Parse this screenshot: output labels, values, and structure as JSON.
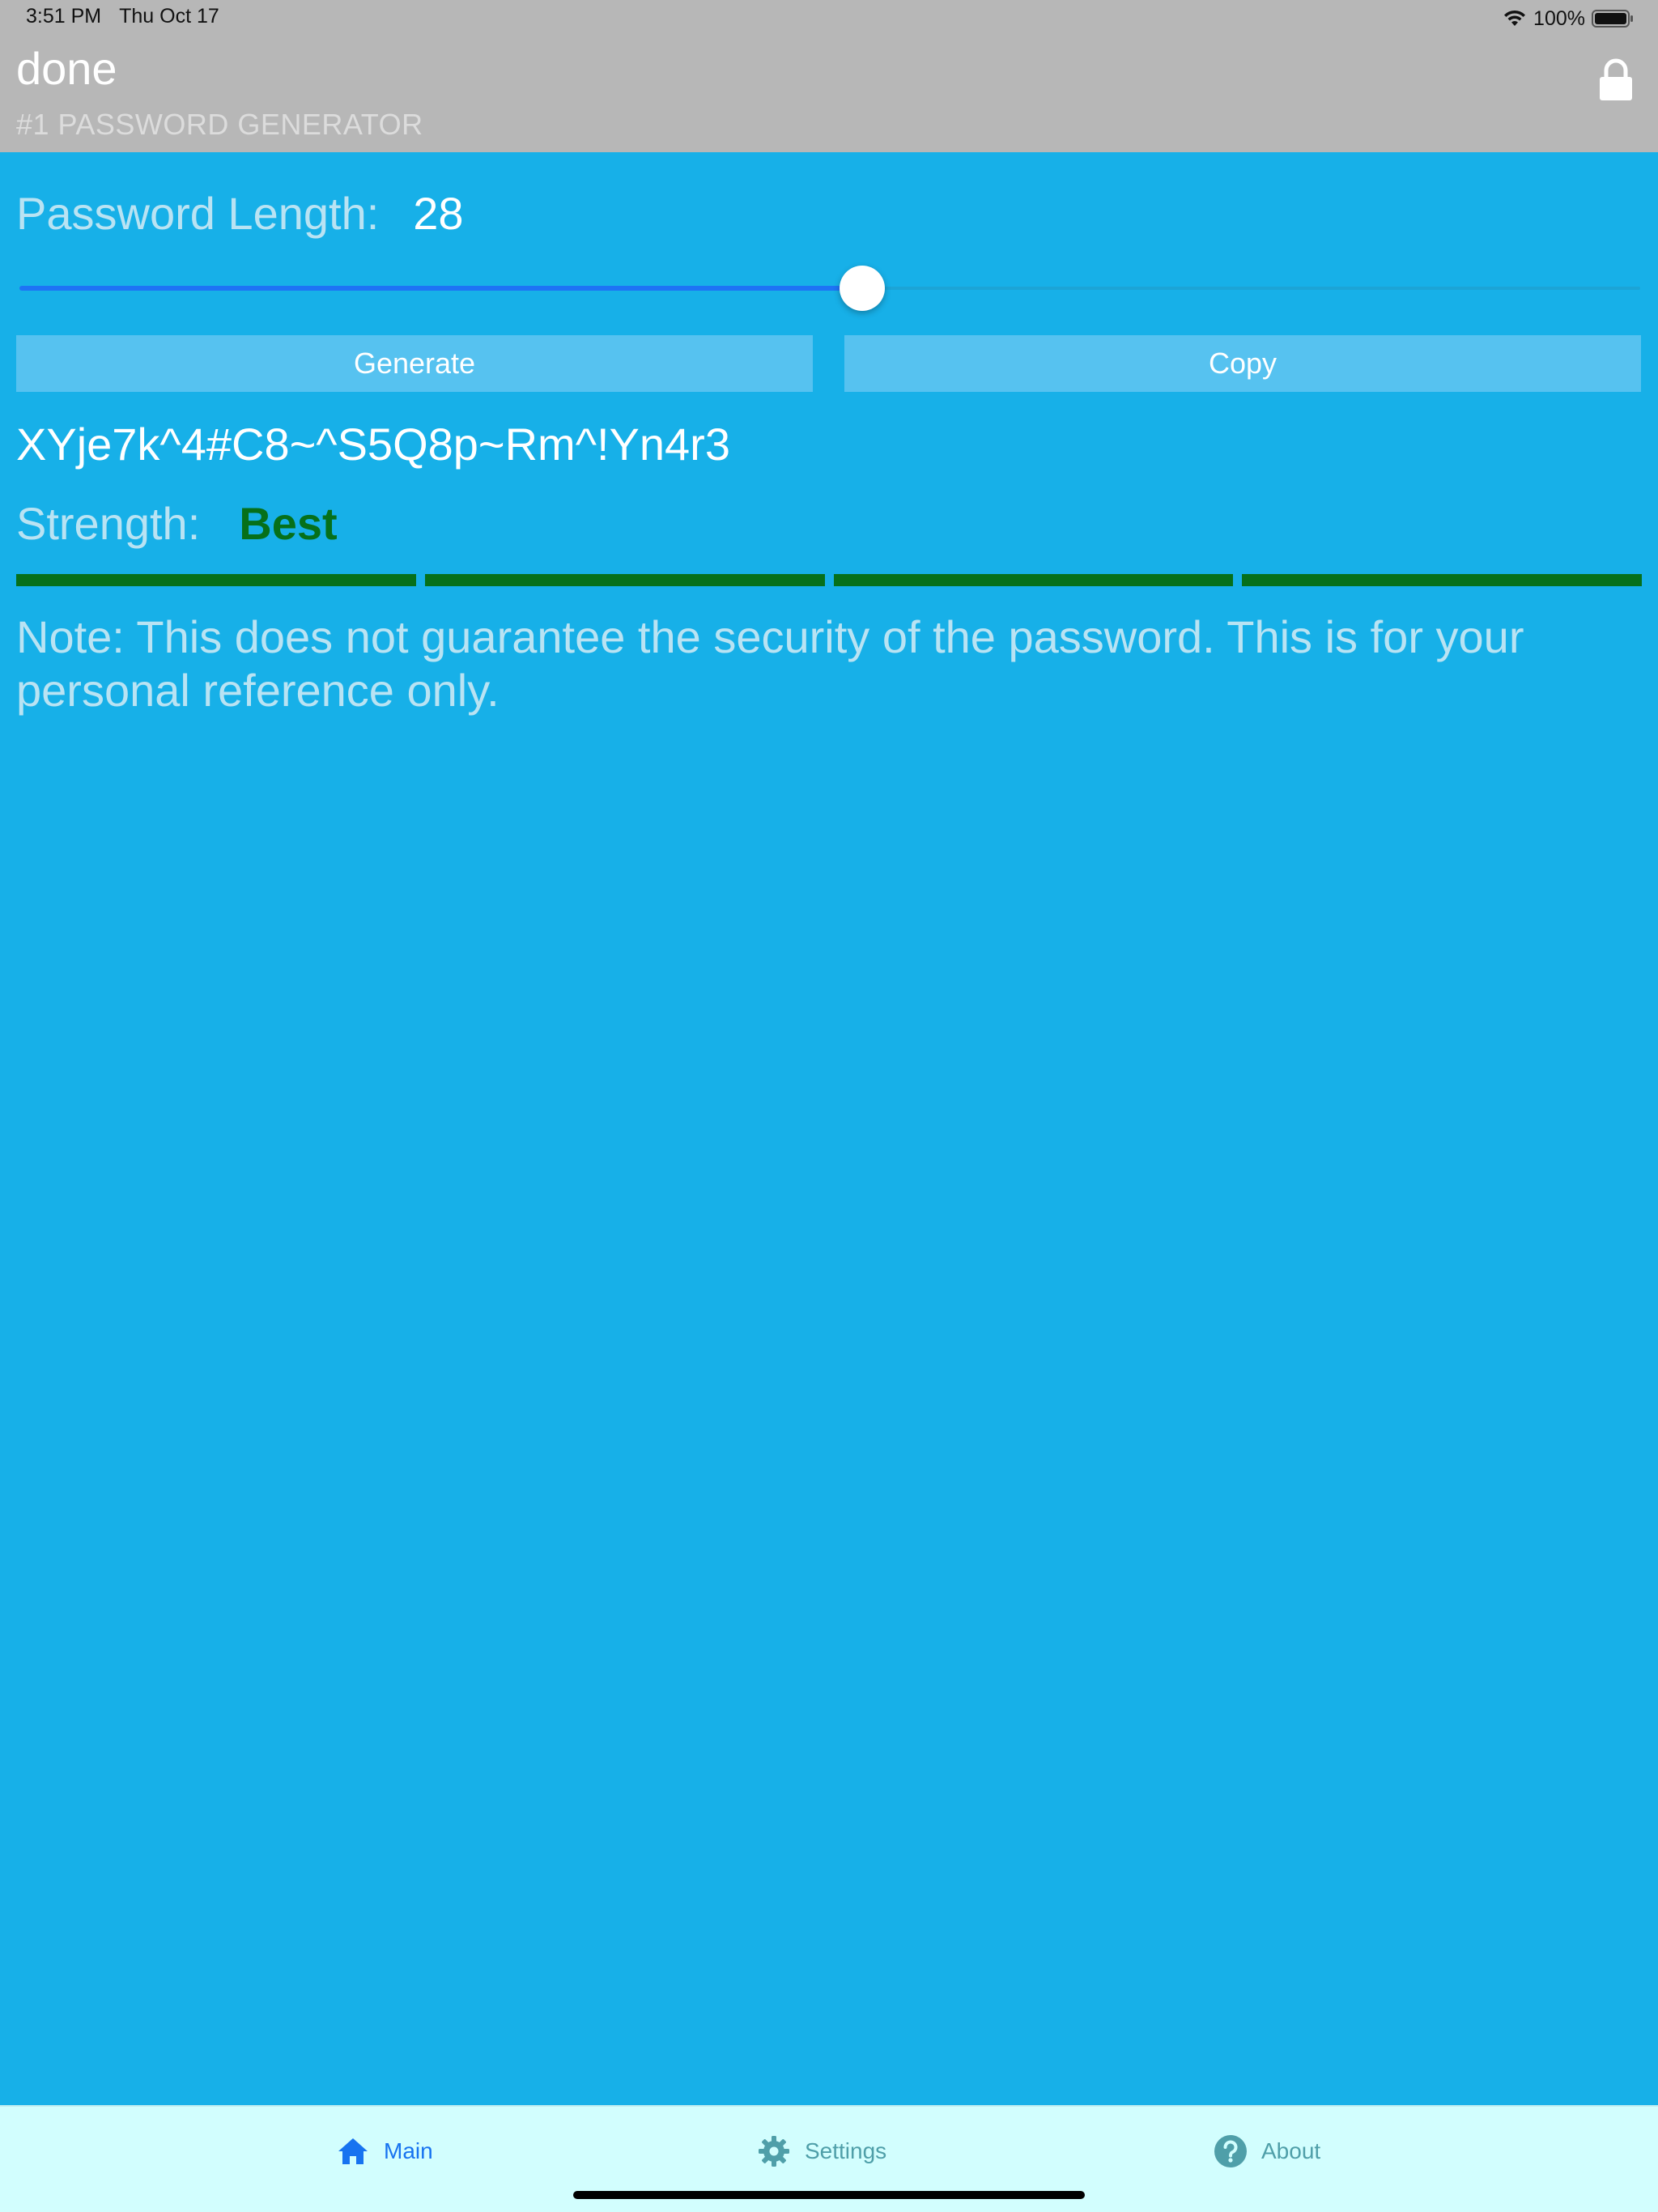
{
  "status_bar": {
    "time": "3:51 PM",
    "date": "Thu Oct 17",
    "battery": "100%"
  },
  "header": {
    "title": "done",
    "subtitle": "#1 PASSWORD GENERATOR",
    "action_icon": "lock-icon"
  },
  "main": {
    "length_label": "Password Length:",
    "length_value": "28",
    "slider": {
      "value": 28,
      "fill_fraction": 0.52
    },
    "generate_label": "Generate",
    "copy_label": "Copy",
    "password": "XYje7k^4#C8~^S5Q8p~Rm^!Yn4r3",
    "strength_label": "Strength:",
    "strength_value": "Best",
    "strength_segments_filled": 4,
    "strength_segments_total": 4,
    "note": "Note: This does not guarantee the security of the password. This is for your personal reference only."
  },
  "tabbar": {
    "tabs": [
      {
        "label": "Main",
        "icon": "home-icon",
        "active": true
      },
      {
        "label": "Settings",
        "icon": "gear-icon",
        "active": false
      },
      {
        "label": "About",
        "icon": "question-icon",
        "active": false
      }
    ]
  },
  "colors": {
    "background": "#17b0e8",
    "header": "#b7b7b7",
    "button": "#56c2f0",
    "strength": "#06701a",
    "tab_active": "#1773f0",
    "tab_inactive": "#4f9fa9",
    "tabbar": "#d2fefe"
  }
}
